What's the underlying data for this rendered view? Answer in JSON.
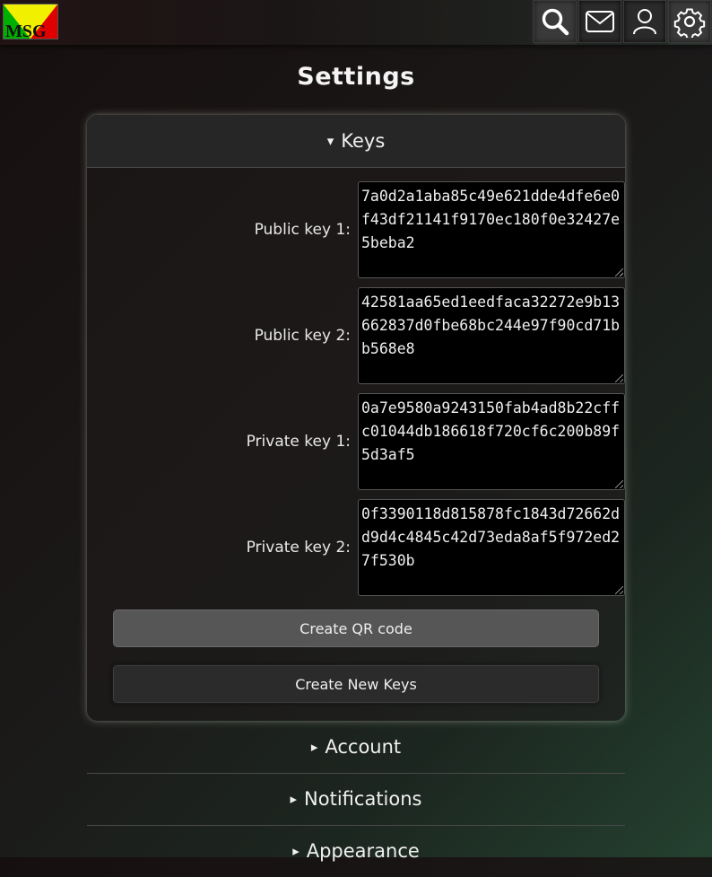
{
  "header": {
    "logo_text": "MSG",
    "icons": [
      "search-icon",
      "mail-icon",
      "user-icon",
      "gear-icon"
    ]
  },
  "page": {
    "title": "Settings"
  },
  "keys_panel": {
    "arrow": "▾",
    "title": "Keys",
    "rows": [
      {
        "label": "Public key 1:",
        "value": "7a0d2a1aba85c49e621dde4dfe6e0f43df21141f9170ec180f0e32427e5beba2"
      },
      {
        "label": "Public key 2:",
        "value": "42581aa65ed1eedfaca32272e9b13662837d0fbe68bc244e97f90cd71bb568e8"
      },
      {
        "label": "Private key 1:",
        "value": "0a7e9580a9243150fab4ad8b22cffc01044db186618f720cf6c200b89f5d3af5"
      },
      {
        "label": "Private key 2:",
        "value": "0f3390118d815878fc1843d72662dd9d4c4845c42d73eda8af5f972ed27f530b"
      }
    ],
    "qr_button": "Create QR code",
    "new_keys_button": "Create New Keys"
  },
  "sections": [
    {
      "arrow": "▸",
      "label": "Account"
    },
    {
      "arrow": "▸",
      "label": "Notifications"
    },
    {
      "arrow": "▸",
      "label": "Appearance"
    }
  ],
  "colors": {
    "logo_yellow": "#f0f000",
    "logo_green": "#00b000",
    "logo_red": "#e00000",
    "key_box_bg": "#000000"
  }
}
